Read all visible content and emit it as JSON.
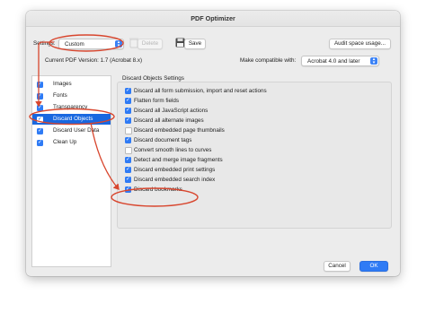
{
  "window": {
    "title": "PDF Optimizer"
  },
  "settings": {
    "label": "Settings:",
    "value": "Custom",
    "delete_label": "Delete",
    "save_label": "Save",
    "audit_label": "Audit space usage..."
  },
  "version": {
    "current_label": "Current PDF Version: 1.7 (Acrobat 8.x)",
    "compatible_label": "Make compatible with:",
    "compatible_value": "Acrobat 4.0 and later"
  },
  "sidebar": {
    "items": [
      {
        "label": "Images",
        "checked": true,
        "selected": false
      },
      {
        "label": "Fonts",
        "checked": true,
        "selected": false
      },
      {
        "label": "Transparency",
        "checked": true,
        "selected": false
      },
      {
        "label": "Discard Objects",
        "checked": true,
        "selected": true
      },
      {
        "label": "Discard User Data",
        "checked": true,
        "selected": false
      },
      {
        "label": "Clean Up",
        "checked": true,
        "selected": false
      }
    ]
  },
  "panel": {
    "heading": "Discard Objects Settings",
    "options": [
      {
        "label": "Discard all form submission, import and reset actions",
        "checked": true
      },
      {
        "label": "Flatten form fields",
        "checked": true
      },
      {
        "label": "Discard all JavaScript actions",
        "checked": true
      },
      {
        "label": "Discard all alternate images",
        "checked": true
      },
      {
        "label": "Discard embedded page thumbnails",
        "checked": false
      },
      {
        "label": "Discard document tags",
        "checked": true
      },
      {
        "label": "Convert smooth lines to curves",
        "checked": false
      },
      {
        "label": "Detect and merge image fragments",
        "checked": true
      },
      {
        "label": "Discard embedded print settings",
        "checked": true
      },
      {
        "label": "Discard embedded search index",
        "checked": true
      },
      {
        "label": "Discard bookmarks",
        "checked": true
      }
    ]
  },
  "footer": {
    "cancel_label": "Cancel",
    "ok_label": "OK"
  },
  "colors": {
    "accent": "#2f7bf5",
    "selection": "#1968e0",
    "annotation": "#d8462e"
  }
}
